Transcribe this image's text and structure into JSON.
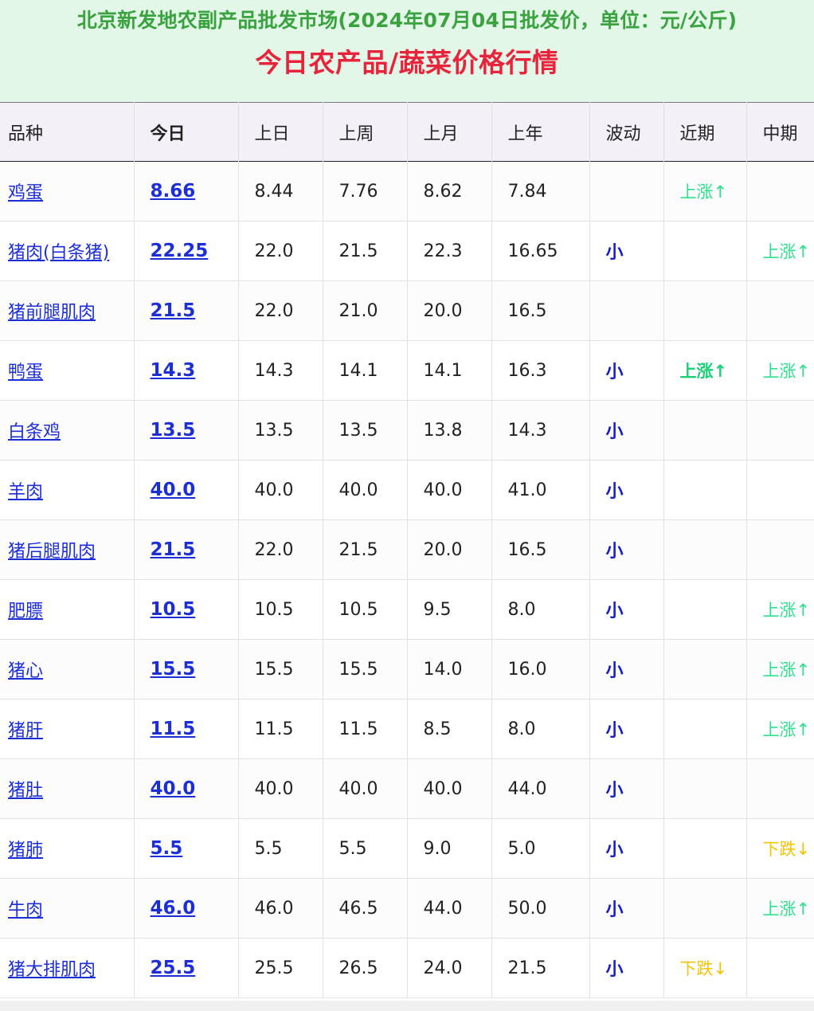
{
  "header": {
    "subtitle": "北京新发地农副产品批发市场(2024年07月04日批发价，单位：元/公斤)",
    "title": "今日农产品/蔬菜价格行情"
  },
  "table": {
    "columns": [
      "品种",
      "今日",
      "上日",
      "上周",
      "上月",
      "上年",
      "波动",
      "近期",
      "中期"
    ],
    "rows": [
      {
        "name": "鸡蛋",
        "today": "8.66",
        "prev_day": "8.44",
        "prev_week": "7.76",
        "prev_month": "8.62",
        "prev_year": "7.84",
        "volatility": "",
        "recent": "上涨↑",
        "recent_type": "up",
        "mid": "",
        "mid_type": ""
      },
      {
        "name": "猪肉(白条猪)",
        "today": "22.25",
        "prev_day": "22.0",
        "prev_week": "21.5",
        "prev_month": "22.3",
        "prev_year": "16.65",
        "volatility": "小",
        "recent": "",
        "recent_type": "",
        "mid": "上涨↑",
        "mid_type": "up"
      },
      {
        "name": "猪前腿肌肉",
        "today": "21.5",
        "prev_day": "22.0",
        "prev_week": "21.0",
        "prev_month": "20.0",
        "prev_year": "16.5",
        "volatility": "",
        "recent": "",
        "recent_type": "",
        "mid": "",
        "mid_type": ""
      },
      {
        "name": "鸭蛋",
        "today": "14.3",
        "prev_day": "14.3",
        "prev_week": "14.1",
        "prev_month": "14.1",
        "prev_year": "16.3",
        "volatility": "小",
        "recent": "上涨↑",
        "recent_type": "up-strong",
        "mid": "上涨↑",
        "mid_type": "up"
      },
      {
        "name": "白条鸡",
        "today": "13.5",
        "prev_day": "13.5",
        "prev_week": "13.5",
        "prev_month": "13.8",
        "prev_year": "14.3",
        "volatility": "小",
        "recent": "",
        "recent_type": "",
        "mid": "",
        "mid_type": ""
      },
      {
        "name": "羊肉",
        "today": "40.0",
        "prev_day": "40.0",
        "prev_week": "40.0",
        "prev_month": "40.0",
        "prev_year": "41.0",
        "volatility": "小",
        "recent": "",
        "recent_type": "",
        "mid": "",
        "mid_type": ""
      },
      {
        "name": "猪后腿肌肉",
        "today": "21.5",
        "prev_day": "22.0",
        "prev_week": "21.5",
        "prev_month": "20.0",
        "prev_year": "16.5",
        "volatility": "小",
        "recent": "",
        "recent_type": "",
        "mid": "",
        "mid_type": ""
      },
      {
        "name": "肥膘",
        "today": "10.5",
        "prev_day": "10.5",
        "prev_week": "10.5",
        "prev_month": "9.5",
        "prev_year": "8.0",
        "volatility": "小",
        "recent": "",
        "recent_type": "",
        "mid": "上涨↑",
        "mid_type": "up"
      },
      {
        "name": "猪心",
        "today": "15.5",
        "prev_day": "15.5",
        "prev_week": "15.5",
        "prev_month": "14.0",
        "prev_year": "16.0",
        "volatility": "小",
        "recent": "",
        "recent_type": "",
        "mid": "上涨↑",
        "mid_type": "up"
      },
      {
        "name": "猪肝",
        "today": "11.5",
        "prev_day": "11.5",
        "prev_week": "11.5",
        "prev_month": "8.5",
        "prev_year": "8.0",
        "volatility": "小",
        "recent": "",
        "recent_type": "",
        "mid": "上涨↑",
        "mid_type": "up"
      },
      {
        "name": "猪肚",
        "today": "40.0",
        "prev_day": "40.0",
        "prev_week": "40.0",
        "prev_month": "40.0",
        "prev_year": "44.0",
        "volatility": "小",
        "recent": "",
        "recent_type": "",
        "mid": "",
        "mid_type": ""
      },
      {
        "name": "猪肺",
        "today": "5.5",
        "prev_day": "5.5",
        "prev_week": "5.5",
        "prev_month": "9.0",
        "prev_year": "5.0",
        "volatility": "小",
        "recent": "",
        "recent_type": "",
        "mid": "下跌↓",
        "mid_type": "down"
      },
      {
        "name": "牛肉",
        "today": "46.0",
        "prev_day": "46.0",
        "prev_week": "46.5",
        "prev_month": "44.0",
        "prev_year": "50.0",
        "volatility": "小",
        "recent": "",
        "recent_type": "",
        "mid": "上涨↑",
        "mid_type": "up"
      },
      {
        "name": "猪大排肌肉",
        "today": "25.5",
        "prev_day": "25.5",
        "prev_week": "26.5",
        "prev_month": "24.0",
        "prev_year": "21.5",
        "volatility": "小",
        "recent": "下跌↓",
        "recent_type": "down",
        "mid": "",
        "mid_type": ""
      }
    ]
  },
  "colors": {
    "header_bg": "#e3f7e8",
    "subtitle": "#3aa33f",
    "title": "#e8243c",
    "link": "#1c2fd6",
    "up": "#2fe08d",
    "down": "#f5c400"
  }
}
